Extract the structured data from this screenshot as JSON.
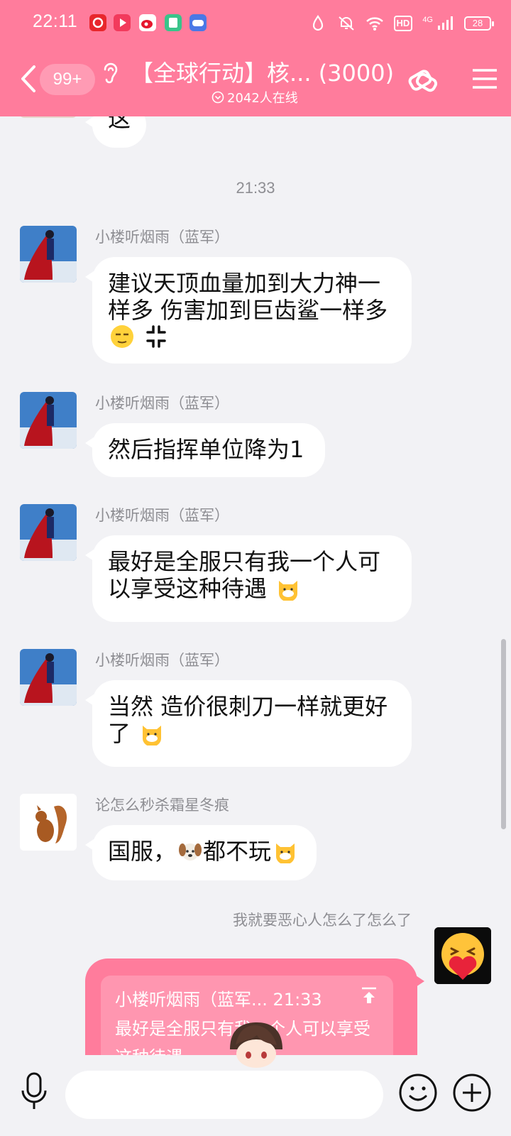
{
  "status_bar": {
    "time": "22:11",
    "hd": "HD",
    "network": "4G",
    "battery": "28"
  },
  "header": {
    "unread_count": "99+",
    "title": "【全球行动】核... (3000)",
    "online": "2042人在线",
    "color": "#ff7c9c"
  },
  "messages": [
    {
      "type": "bubble-partial",
      "text": "这"
    },
    {
      "type": "timestamp",
      "text": "21:33"
    },
    {
      "sender": "小楼听烟雨（蓝军）",
      "text": "建议天顶血量加到大力神一样多 伤害加到巨齿鲨一样多",
      "emojis": [
        "smirk-emoji",
        "anger-emoji"
      ]
    },
    {
      "sender": "小楼听烟雨（蓝军）",
      "text": "然后指挥单位降为1",
      "emojis": []
    },
    {
      "sender": "小楼听烟雨（蓝军）",
      "text": "最好是全服只有我一个人可以享受这种待遇",
      "emojis": [
        "cat-emoji"
      ]
    },
    {
      "sender": "小楼听烟雨（蓝军）",
      "text": "当然 造价很刺刀一样就更好了",
      "emojis": [
        "cat-emoji"
      ]
    },
    {
      "sender": "论怎么秒杀霜星冬痕",
      "text_before": "国服，",
      "text_after": "都不玩",
      "emojis": [
        "dog-emoji",
        "cat-emoji"
      ]
    }
  ],
  "my_message": {
    "sender": "我就要恶心人怎么了怎么了",
    "quote_author": "小楼听烟雨（蓝军...",
    "quote_time": "21:33",
    "quote_text": "最好是全服只有我一个人可以享受这种待遇"
  },
  "input": {
    "placeholder": ""
  }
}
